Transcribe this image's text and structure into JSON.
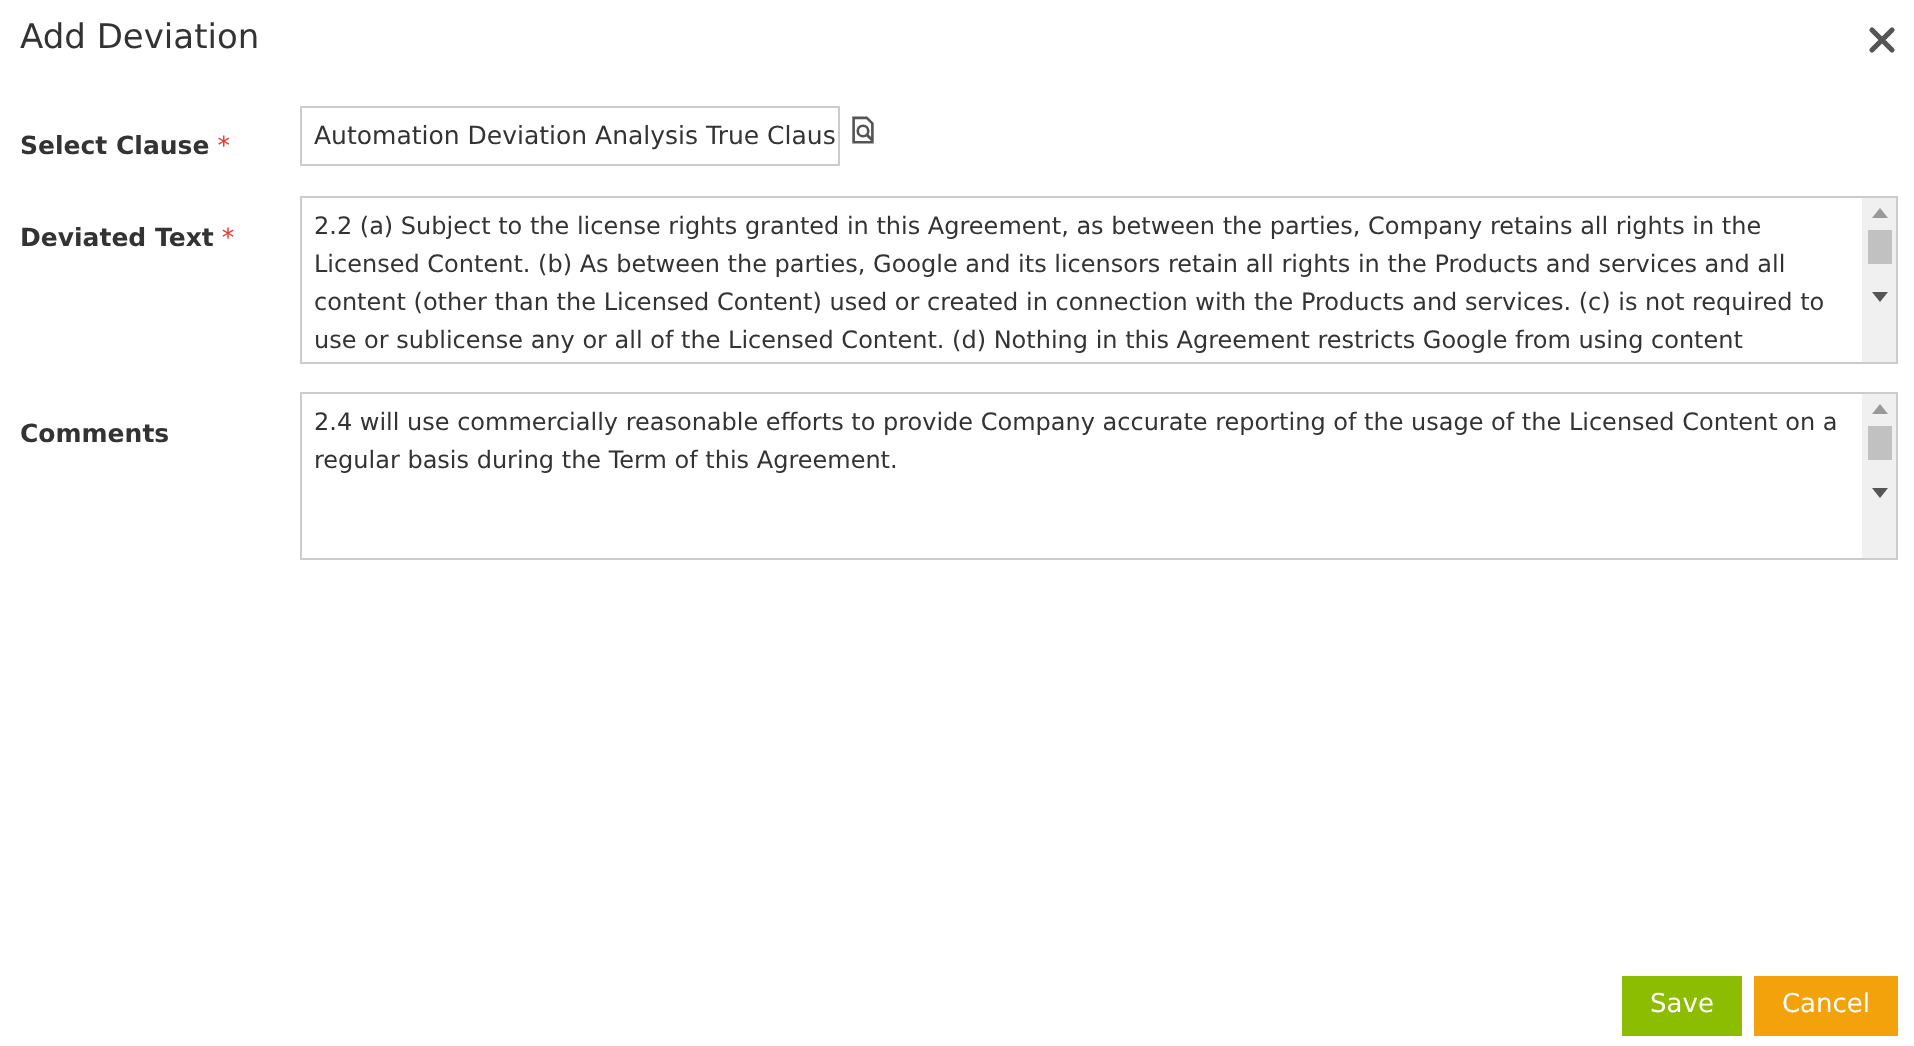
{
  "dialog": {
    "title": "Add Deviation"
  },
  "fields": [
    {
      "kind": "lookup",
      "label": "Select Clause",
      "required_marker": "*",
      "value": "Automation Deviation Analysis True Claus"
    },
    {
      "kind": "textarea",
      "label": "Deviated Text",
      "required_marker": "*",
      "value": "2.2  (a) Subject to the license rights granted in this Agreement, as between the parties, Company retains all rights in the Licensed Content. (b) As between the parties, Google and its licensors retain all rights in the Products and services and all content (other than the Licensed Content) used or created in connection with the Products and services. (c)  is not required to use or sublicense any or all of the Licensed Content. (d) Nothing in this Agreement restricts Google from using content"
    },
    {
      "kind": "textarea",
      "label": "Comments",
      "value": "2.4  will use commercially reasonable efforts to provide Company accurate reporting of the usage of the Licensed Content on a regular basis during the Term of this Agreement."
    }
  ],
  "buttons": [
    {
      "kind": "primary",
      "label": "Save"
    },
    {
      "kind": "cancel",
      "label": "Cancel"
    }
  ]
}
